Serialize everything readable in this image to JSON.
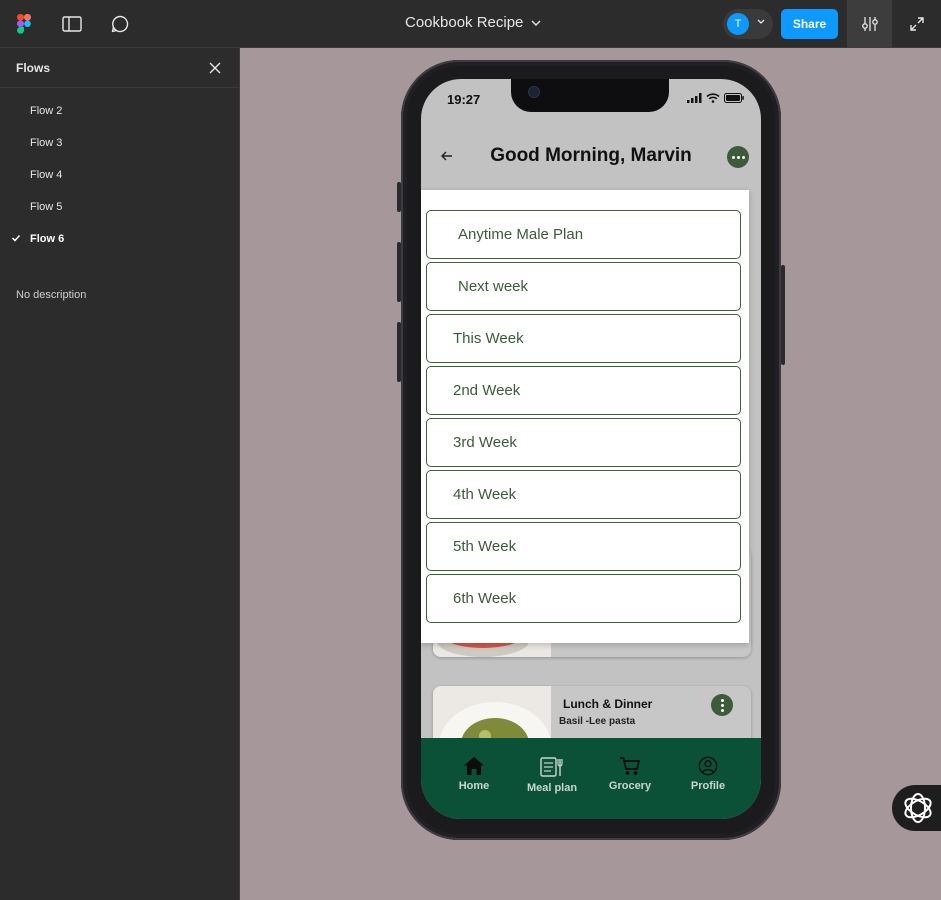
{
  "topbar": {
    "file_title": "Cookbook Recipe",
    "avatar_initial": "T",
    "share_label": "Share"
  },
  "sidebar": {
    "title": "Flows",
    "flows": [
      {
        "label": "Flow 2",
        "active": false
      },
      {
        "label": "Flow 3",
        "active": false
      },
      {
        "label": "Flow 4",
        "active": false
      },
      {
        "label": "Flow 5",
        "active": false
      },
      {
        "label": "Flow 6",
        "active": true
      }
    ],
    "description": "No description"
  },
  "phone": {
    "status_time": "19:27",
    "greeting": "Good Morning, Marvin",
    "dropdown_options": [
      "Anytime Male Plan",
      "Next week",
      "This Week",
      "2nd Week",
      "3rd Week",
      "4th Week",
      "5th Week",
      "6th Week"
    ],
    "card": {
      "title": "Lunch & Dinner",
      "subtitle": "Basil -Lee pasta"
    },
    "nav": [
      {
        "label": "Home",
        "icon": "home-icon"
      },
      {
        "label": "Meal plan",
        "icon": "meal-plan-icon"
      },
      {
        "label": "Grocery",
        "icon": "cart-icon"
      },
      {
        "label": "Profile",
        "icon": "profile-icon"
      }
    ]
  },
  "colors": {
    "canvas_bg": "#a6979a",
    "brand_green": "#0b5138",
    "accent_green": "#3d5a3a",
    "figma_blue": "#0d99ff"
  }
}
